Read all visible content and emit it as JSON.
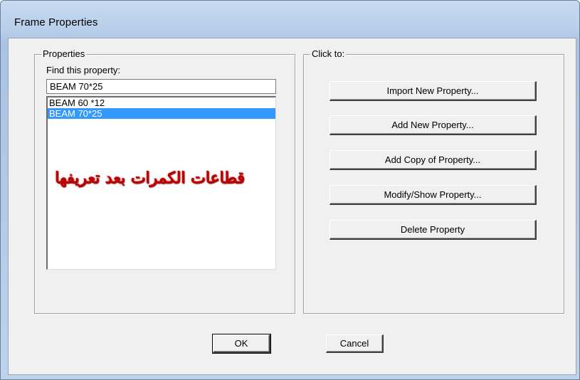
{
  "window": {
    "title": "Frame Properties"
  },
  "properties_group": {
    "legend": "Properties",
    "find_label": "Find this property:",
    "find_value": "BEAM 70*25",
    "items": [
      {
        "label": "BEAM 60 *12",
        "selected": false
      },
      {
        "label": "BEAM 70*25",
        "selected": true
      }
    ],
    "annotation": "قطاعات الكمرات بعد تعريفها"
  },
  "click_group": {
    "legend": "Click to:",
    "buttons": [
      "Import New Property...",
      "Add New Property...",
      "Add Copy of Property...",
      "Modify/Show Property...",
      "Delete Property"
    ]
  },
  "footer": {
    "ok_label": "OK",
    "cancel_label": "Cancel"
  },
  "colors": {
    "selection": "#3399ff",
    "annotation_text": "#c00000",
    "dialog_face": "#f0f0f0",
    "title_bar": "#b6cde9"
  }
}
